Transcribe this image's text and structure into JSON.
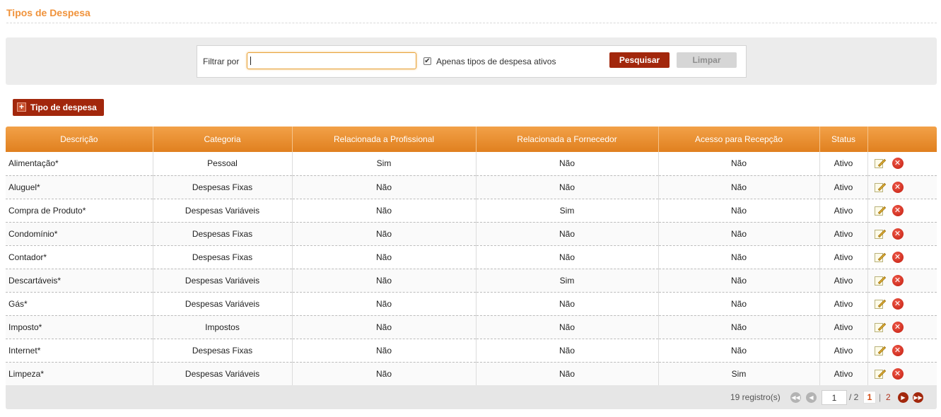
{
  "page": {
    "title": "Tipos de Despesa"
  },
  "filter": {
    "label": "Filtrar por",
    "value": "",
    "active_only_label": "Apenas tipos de despesa ativos",
    "active_only_checked": true,
    "search_label": "Pesquisar",
    "clear_label": "Limpar"
  },
  "add_button": {
    "label": "Tipo de despesa",
    "icon": "plus-icon"
  },
  "table": {
    "headers": [
      "Descrição",
      "Categoria",
      "Relacionada a Profissional",
      "Relacionada a Fornecedor",
      "Acesso para Recepção",
      "Status",
      ""
    ],
    "rows": [
      [
        "Alimentação*",
        "Pessoal",
        "Sim",
        "Não",
        "Não",
        "Ativo"
      ],
      [
        "Aluguel*",
        "Despesas Fixas",
        "Não",
        "Não",
        "Não",
        "Ativo"
      ],
      [
        "Compra de Produto*",
        "Despesas Variáveis",
        "Não",
        "Sim",
        "Não",
        "Ativo"
      ],
      [
        "Condomínio*",
        "Despesas Fixas",
        "Não",
        "Não",
        "Não",
        "Ativo"
      ],
      [
        "Contador*",
        "Despesas Fixas",
        "Não",
        "Não",
        "Não",
        "Ativo"
      ],
      [
        "Descartáveis*",
        "Despesas Variáveis",
        "Não",
        "Sim",
        "Não",
        "Ativo"
      ],
      [
        "Gás*",
        "Despesas Variáveis",
        "Não",
        "Não",
        "Não",
        "Ativo"
      ],
      [
        "Imposto*",
        "Impostos",
        "Não",
        "Não",
        "Não",
        "Ativo"
      ],
      [
        "Internet*",
        "Despesas Fixas",
        "Não",
        "Não",
        "Não",
        "Ativo"
      ],
      [
        "Limpeza*",
        "Despesas Variáveis",
        "Não",
        "Não",
        "Sim",
        "Ativo"
      ]
    ],
    "row_actions": [
      "edit-icon",
      "delete-icon"
    ]
  },
  "pagination": {
    "records": "19 registro(s)",
    "page_input": "1",
    "total": "/ 2",
    "current": "1",
    "separator": "|",
    "next_page": "2"
  },
  "colors": {
    "accent": "#f0923a",
    "button": "#a2270c",
    "header": "#e88d2e"
  }
}
